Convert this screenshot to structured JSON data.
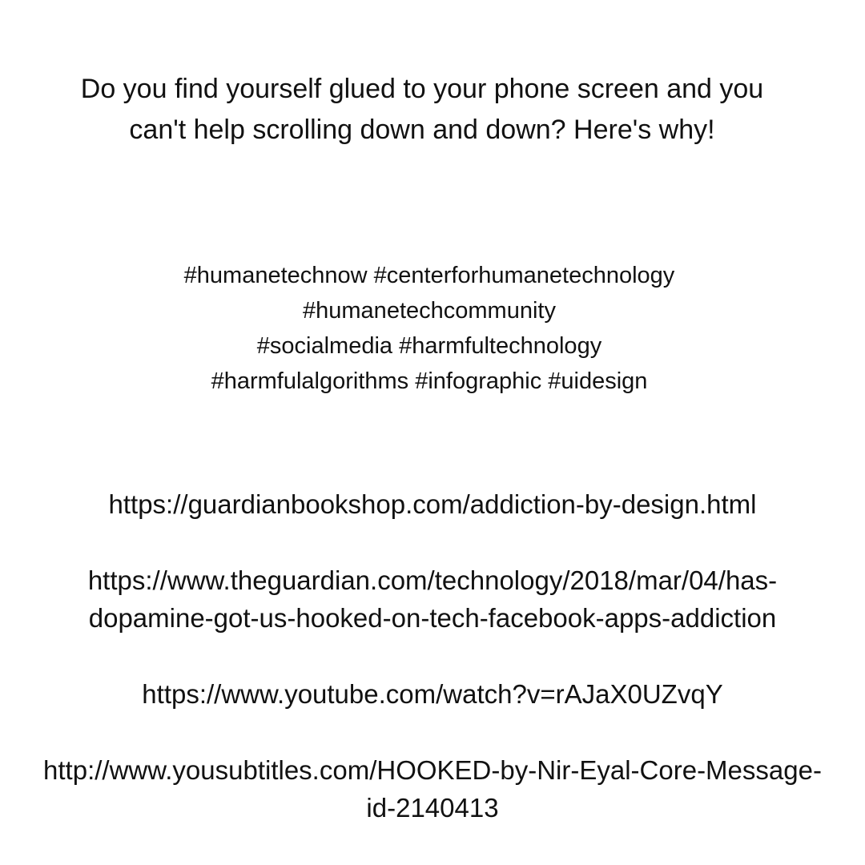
{
  "headline": {
    "line1": "Do you find yourself glued to your phone screen and you",
    "line2": "can't help scrolling down and down? Here's why!"
  },
  "hashtags": {
    "line1": "#humanetechnow #centerforhumanetechnology",
    "line2": "#humanetechcommunity",
    "line3": "#socialmedia #harmfultechnology",
    "line4": "#harmfulalgorithms #infographic #uidesign"
  },
  "links": {
    "guardian_bookshop": "https://guardianbookshop.com/addiction-by-design.html",
    "guardian_article_line1": "https://www.theguardian.com/technology/2018/mar/04/has-",
    "guardian_article_line2": "dopamine-got-us-hooked-on-tech-facebook-apps-addiction",
    "youtube": "https://www.youtube.com/watch?v=rAJaX0UZvqY",
    "yousubtitles_line1": "http://www.yousubtitles.com/HOOKED-by-Nir-Eyal-Core-Message-",
    "yousubtitles_line2": "id-2140413"
  }
}
